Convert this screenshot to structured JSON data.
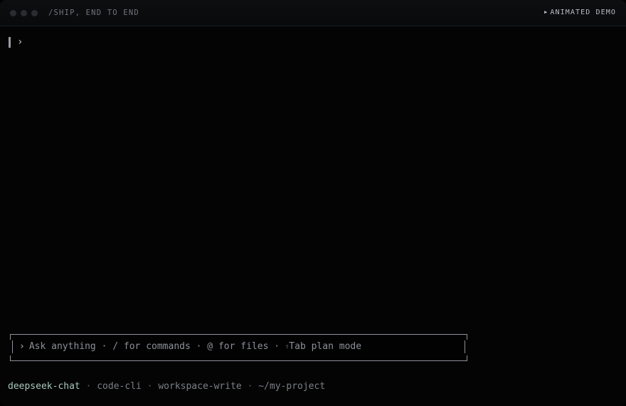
{
  "window": {
    "title": "/SHIP, END TO END",
    "badge": "ANIMATED DEMO",
    "badge_icon": "play-triangle-icon"
  },
  "terminal": {
    "prompt_symbol": "›"
  },
  "input": {
    "chevron": "›",
    "placeholder_parts": {
      "ask": "Ask anything",
      "commands": "/ for commands",
      "files": "@ for files",
      "shift_glyph": "⇧",
      "plan": "Tab plan mode"
    },
    "separator": "·"
  },
  "status_bar": {
    "model": "deepseek-chat",
    "profile": "code-cli",
    "permission": "workspace-write",
    "path": "~/my-project",
    "separator": "·"
  },
  "colors": {
    "background": "#040405",
    "titlebar": "#0d0e10",
    "model_accent": "#a9c6bb",
    "muted_text": "#7b7f86"
  }
}
